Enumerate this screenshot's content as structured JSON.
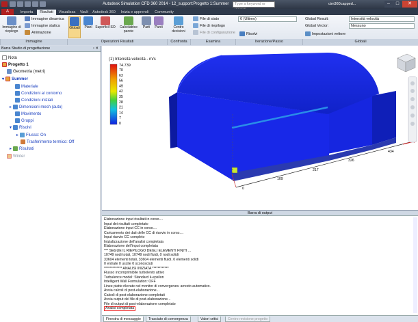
{
  "titlebar": {
    "title": "Autodesk Simulation CFD 360 2014 - 12_support:Progetto 1:Summer",
    "search_placeholder": "Type a keyword or phrase",
    "user": "cim360capped..."
  },
  "tabs": [
    "Importa",
    "Risultati",
    "Visualizza",
    "Vault",
    "Autodesk 360",
    "Inizia e apprendi",
    "Community"
  ],
  "ribbon": {
    "immagine": {
      "riepilogo": "Immagine di riepilogo",
      "dinamica": "Immagine dinamica",
      "statica": "Immagine statica",
      "animazione": "Animazione"
    },
    "operazioni": {
      "globali": "Globali",
      "piani": "Piani",
      "superfici": "Superfici ISO",
      "calcolatrice": "Calcolatrice parete",
      "parti": "Parti",
      "punti": "Punti"
    },
    "confronta": {
      "centro": "Centro decisioni"
    },
    "esamina": {
      "stato": "File di stato",
      "riepilogo": "File di riepilogo",
      "config": "File di configurazione"
    },
    "iterazione": {
      "value": "6 (Ultimo)",
      "risolvi": "Risolvi"
    },
    "globali": {
      "result_label": "Global Result:",
      "result_value": "Intensità velocità",
      "vector_label": "Global Vector:",
      "vector_value": "Nessuno",
      "impostazioni": "Impostazioni vettore"
    },
    "groups": [
      "Immagine",
      "Operazioni Risultati",
      "Confronta",
      "Esamina",
      "Iterazione/Passo",
      "Globali"
    ]
  },
  "sidebar": {
    "header": "Barra Studio di progettazione",
    "items": [
      "Nota",
      "Progetto 1",
      "Geometria (metri)",
      "Summer",
      "Materiale",
      "Condizioni al contorno",
      "Condizioni iniziali",
      "Dimensioni mesh (auto)",
      "Movimento",
      "Gruppi",
      "Risolvi",
      "Flusso: On",
      "Trasferimento termico: Off",
      "Risultati",
      "Winter"
    ]
  },
  "legend": {
    "title": "(1) Intensità velocità - m/s",
    "max": "74.739",
    "ticks": [
      "70",
      "63",
      "56",
      "49",
      "42",
      "35",
      "28",
      "21",
      "14",
      "7",
      "0"
    ]
  },
  "ruler": [
    "0",
    "109",
    "217",
    "326",
    "434"
  ],
  "output": {
    "header": "Barra di output",
    "lines": [
      "Elaborazione input risultati in corso....",
      "Input dei risultati completato",
      "Elaborazione input CC in corso....",
      "Caricamento dei dati delle CC di riavvio in corso....",
      "Input riavvio CC completo",
      "Inizializzazione dell'analisi completata",
      "Elaborazione dell'input completata",
      "*** SEGUE IL RIEPILOGO DEGLI ELEMENTI FINITI ...",
      "10749 nodi totali,    10749 nodi fluidi,    0 nodi solidi",
      "33604 elementi totali,   33604 elementi fluidi,    0 elementi solidi",
      "0 entrate 0 uscite 0 sconosciuti",
      "************* ANALISI INIZIATA ************",
      "Flusso incomprimibile turbolento attivo",
      "Turbulence model: Standard k-epsilon",
      "Intelligent Wall Formulation: OFF",
      "Linee piatte rilevate nel monitor di convergenza: arresto automatico.",
      "Avvia calcoli di post-elaborazione...",
      "Calcoli di post-elaborazione completati",
      "Avvia output del file di post-elaborazione...",
      "File di output di post-elaborazione completato",
      "Analisi completata"
    ],
    "tabs": [
      "Finestra di messaggio",
      "Tracciato di convergenza",
      "Valori critici",
      "Centro revisione progetto"
    ]
  },
  "colors": {
    "model": "#1626e0",
    "accent": "#3465a4"
  }
}
